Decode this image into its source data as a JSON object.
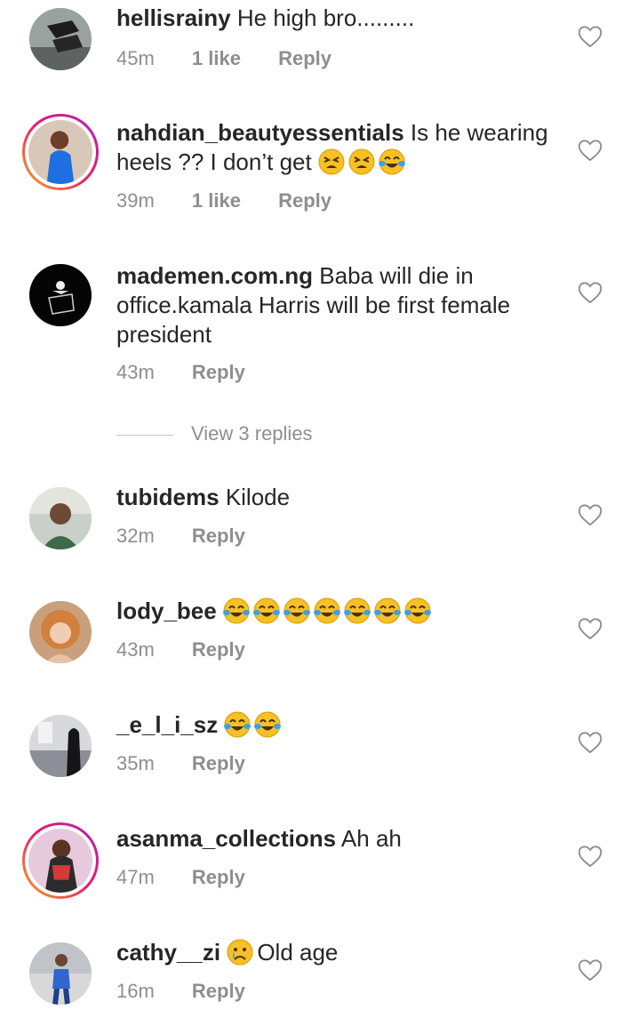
{
  "comments": [
    {
      "username": "hellisrainy",
      "text": "He high bro.........",
      "time": "45m",
      "likes": "1 like",
      "reply": "Reply",
      "emoji": []
    },
    {
      "username": "nahdian_beautyessentials",
      "text": "Is he wearing heels ?? I don’t get",
      "time": "39m",
      "likes": "1 like",
      "reply": "Reply",
      "emoji": [
        "tired-face",
        "tired-face",
        "tears-of-joy"
      ]
    },
    {
      "username": "mademen.com.ng",
      "text": "Baba will die in office.kamala Harris will be first female president",
      "time": "43m",
      "likes": "",
      "reply": "Reply",
      "emoji": []
    },
    {
      "username": "tubidems",
      "text": "Kilode",
      "time": "32m",
      "likes": "",
      "reply": "Reply",
      "emoji": []
    },
    {
      "username": "lody_bee",
      "text": "",
      "time": "43m",
      "likes": "",
      "reply": "Reply",
      "emoji": [
        "tears-of-joy",
        "tears-of-joy",
        "tears-of-joy",
        "tears-of-joy",
        "tears-of-joy",
        "tears-of-joy",
        "tears-of-joy"
      ]
    },
    {
      "username": "_e_l_i_sz",
      "text": "",
      "time": "35m",
      "likes": "",
      "reply": "Reply",
      "emoji": [
        "tears-of-joy",
        "tears-of-joy"
      ]
    },
    {
      "username": "asanma_collections",
      "text": "Ah ah",
      "time": "47m",
      "likes": "",
      "reply": "Reply",
      "emoji": []
    },
    {
      "username": "cathy__zi",
      "text": "Old age",
      "time": "16m",
      "likes": "",
      "reply": "Reply",
      "emoji": [
        "crying-face"
      ]
    }
  ],
  "view_replies": "View 3 replies",
  "icons": {
    "like": "heart-outline-icon"
  },
  "colors": {
    "text": "#262626",
    "meta": "#8e8e8e"
  }
}
